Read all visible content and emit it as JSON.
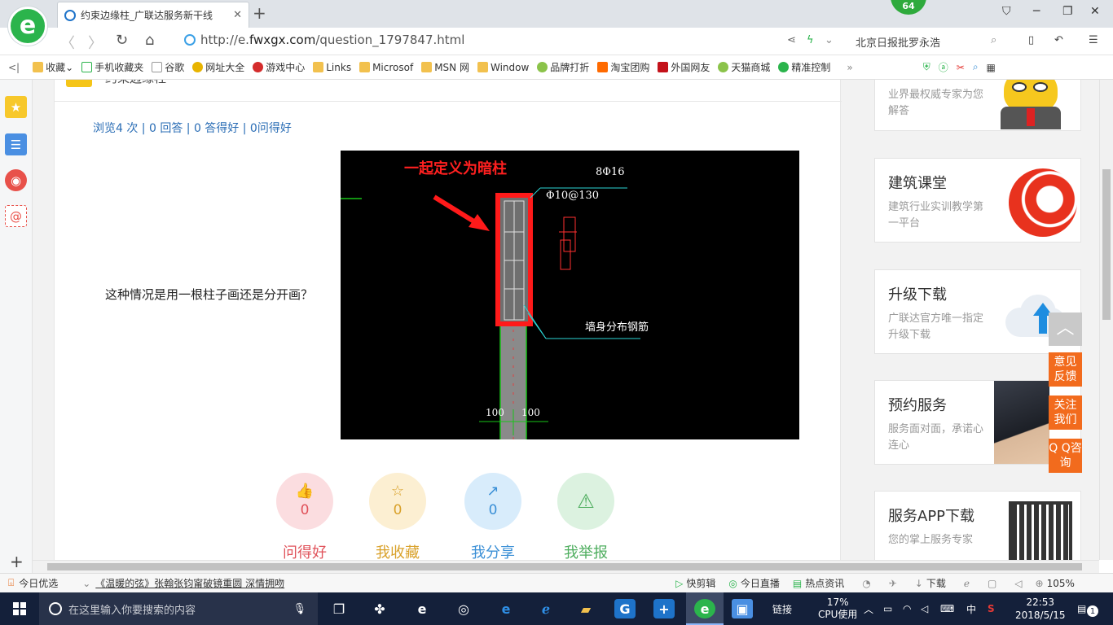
{
  "browser": {
    "tab_title": "约束边缘柱_广联达服务新干线",
    "url_prefix": "http://e.",
    "url_host": "fwxgx.com",
    "url_path": "/question_1797847.html",
    "badge": "64",
    "search_hint": "北京日报批罗永浩"
  },
  "bookmarks": [
    {
      "label": "收藏",
      "icon": "star-icon"
    },
    {
      "label": "手机收藏夹",
      "icon": "phone-icon"
    },
    {
      "label": "谷歌",
      "icon": "page-icon"
    },
    {
      "label": "网址大全",
      "icon": "globe-icon"
    },
    {
      "label": "游戏中心",
      "icon": "game-icon"
    },
    {
      "label": "Links",
      "icon": "folder-icon"
    },
    {
      "label": "Microsof",
      "icon": "folder-icon"
    },
    {
      "label": "MSN 网",
      "icon": "folder-icon"
    },
    {
      "label": "Window",
      "icon": "folder-icon"
    },
    {
      "label": "品牌打折",
      "icon": "leaf-icon"
    },
    {
      "label": "淘宝团购",
      "icon": "taobao-icon"
    },
    {
      "label": "外国网友",
      "icon": "flag-icon"
    },
    {
      "label": "天猫商城",
      "icon": "leaf-icon"
    },
    {
      "label": "精准控制",
      "icon": "chat-icon"
    }
  ],
  "question": {
    "header_partial": "约束边缘柱",
    "stats": "浏览4 次 | 0 回答 | 0 答得好 | 0问得好",
    "text": "这种情况是用一根柱子画还是分开画？"
  },
  "cad_image": {
    "annotation_red": "一起定义为暗柱",
    "rebar_main": "8Φ16",
    "stirrup": "Φ10@130",
    "wall_label": "墙身分布钢筋",
    "dim_left": "100",
    "dim_right": "100"
  },
  "actions": [
    {
      "label": "问得好",
      "count": "0",
      "color": "#e0525a",
      "bg": "#fbdde0",
      "icon": "thumbs-up-icon",
      "glyph": "👍"
    },
    {
      "label": "我收藏",
      "count": "0",
      "color": "#d9a12a",
      "bg": "#fcefd2",
      "icon": "star-icon",
      "glyph": "☆"
    },
    {
      "label": "我分享",
      "count": "0",
      "color": "#3a8fd6",
      "bg": "#d8ecfb",
      "icon": "share-icon",
      "glyph": "↗"
    },
    {
      "label": "我举报",
      "count": "",
      "color": "#4fae5f",
      "bg": "#dcf2e0",
      "icon": "warning-icon",
      "glyph": "⚠"
    }
  ],
  "sidebar_cards": [
    {
      "title": "",
      "sub": "业界最权威专家为您解答",
      "icon": "mascot-icon"
    },
    {
      "title": "建筑课堂",
      "sub": "建筑行业实训教学第一平台",
      "icon": "red-swirl-icon"
    },
    {
      "title": "升级下载",
      "sub": "广联达官方唯一指定升级下载",
      "icon": "cloud-upload-icon"
    },
    {
      "title": "预约服务",
      "sub": "服务面对面，承诺心连心",
      "icon": "handshake-icon"
    },
    {
      "title": "服务APP下载",
      "sub": "您的掌上服务专家",
      "icon": "qr-code-icon"
    }
  ],
  "float_buttons": [
    {
      "label": "意见反馈"
    },
    {
      "label": "关注我们"
    },
    {
      "label": "Q Q咨询"
    }
  ],
  "statusbar": {
    "left": "今日优选",
    "news": "《温暖的弦》张翰张钧甯破镜重圆 深情拥吻",
    "items": [
      "快剪辑",
      "今日直播",
      "热点资讯",
      "下载"
    ],
    "zoom": "105%"
  },
  "taskbar": {
    "search_placeholder": "在这里输入你要搜索的内容",
    "links": "链接",
    "cpu_percent": "17%",
    "cpu_label": "CPU使用",
    "ime": "中",
    "time": "22:53",
    "date": "2018/5/15",
    "notify_count": "1"
  }
}
